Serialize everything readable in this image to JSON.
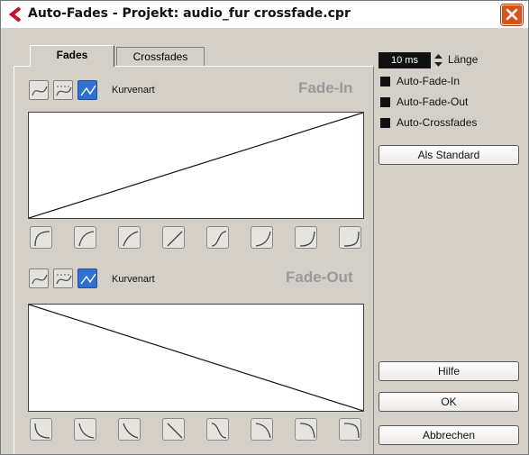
{
  "window": {
    "title": "Auto-Fades - Projekt: audio_fur crossfade.cpr",
    "accent": "#d8541f"
  },
  "tabs": [
    {
      "label": "Fades"
    },
    {
      "label": "Crossfades"
    }
  ],
  "fade_in": {
    "heading": "Fade-In",
    "curve_label": "Kurvenart"
  },
  "fade_out": {
    "heading": "Fade-Out",
    "curve_label": "Kurvenart"
  },
  "length": {
    "value": "10 ms",
    "label": "Länge"
  },
  "options": [
    {
      "label": "Auto-Fade-In"
    },
    {
      "label": "Auto-Fade-Out"
    },
    {
      "label": "Auto-Crossfades"
    }
  ],
  "buttons": {
    "default": "Als Standard",
    "help": "Hilfe",
    "ok": "OK",
    "cancel": "Abbrechen"
  }
}
